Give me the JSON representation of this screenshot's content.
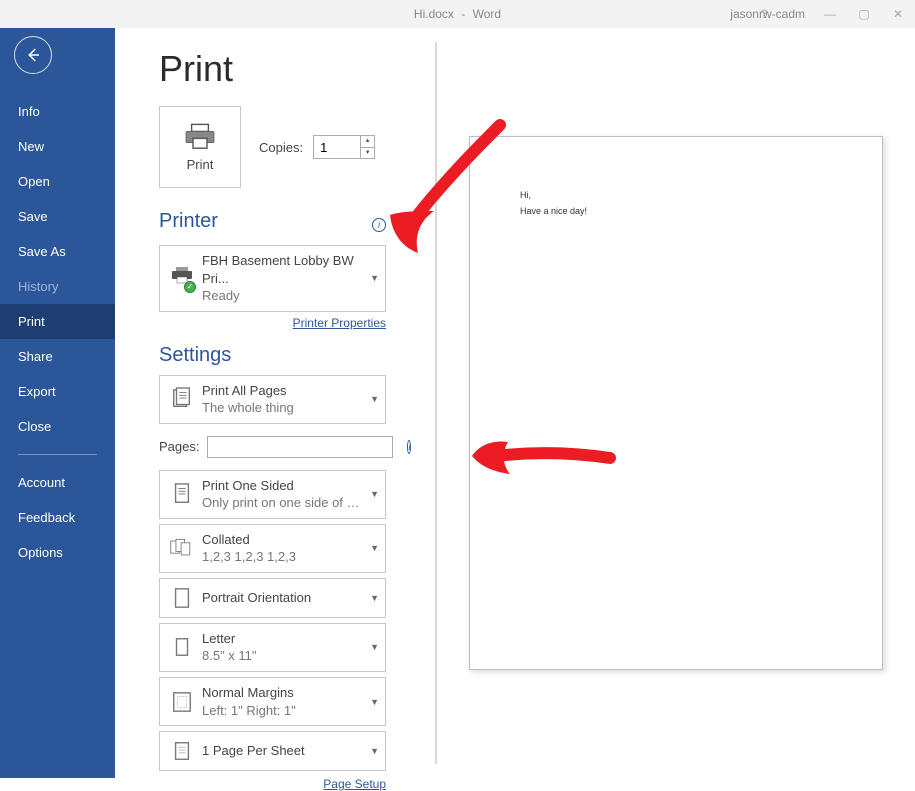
{
  "titlebar": {
    "filename": "Hi.docx",
    "dash": "-",
    "app": "Word",
    "user": "jasonrw-cadm",
    "help": "?",
    "minimize": "—",
    "maximize": "▢",
    "close": "✕"
  },
  "sidebar": {
    "items": [
      {
        "label": "Info",
        "active": false,
        "dim": false
      },
      {
        "label": "New",
        "active": false,
        "dim": false
      },
      {
        "label": "Open",
        "active": false,
        "dim": false
      },
      {
        "label": "Save",
        "active": false,
        "dim": false
      },
      {
        "label": "Save As",
        "active": false,
        "dim": false
      },
      {
        "label": "History",
        "active": false,
        "dim": true
      },
      {
        "label": "Print",
        "active": true,
        "dim": false
      },
      {
        "label": "Share",
        "active": false,
        "dim": false
      },
      {
        "label": "Export",
        "active": false,
        "dim": false
      },
      {
        "label": "Close",
        "active": false,
        "dim": false
      }
    ],
    "footer": [
      {
        "label": "Account"
      },
      {
        "label": "Feedback"
      },
      {
        "label": "Options"
      }
    ]
  },
  "main": {
    "title": "Print",
    "print_button": "Print",
    "copies_label": "Copies:",
    "copies_value": "1",
    "printer_heading": "Printer",
    "printer": {
      "name": "FBH Basement Lobby BW Pri...",
      "status": "Ready"
    },
    "printer_properties": "Printer Properties",
    "settings_heading": "Settings",
    "pages_label": "Pages:",
    "pages_value": "",
    "options": {
      "print_all": {
        "line1": "Print All Pages",
        "line2": "The whole thing"
      },
      "sides": {
        "line1": "Print One Sided",
        "line2": "Only print on one side of th..."
      },
      "collated": {
        "line1": "Collated",
        "line2": "1,2,3    1,2,3    1,2,3"
      },
      "orientation": {
        "line1": "Portrait Orientation"
      },
      "paper": {
        "line1": "Letter",
        "line2": "8.5\" x 11\""
      },
      "margins": {
        "line1": "Normal Margins",
        "line2": "Left:  1\"    Right:  1\""
      },
      "per_sheet": {
        "line1": "1 Page Per Sheet"
      }
    },
    "page_setup": "Page Setup"
  },
  "preview": {
    "line1": "Hi,",
    "line2": "Have a nice day!"
  }
}
